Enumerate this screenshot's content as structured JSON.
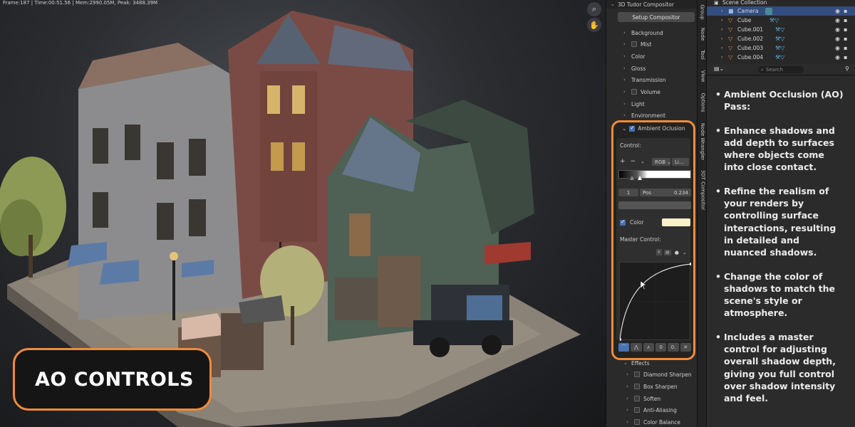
{
  "viewport": {
    "stats": "Frame:187 | Time:00:51.56 | Mem:2990.05M, Peak: 3488.39M",
    "zoom_icon": "zoom-icon",
    "hand_icon": "hand-icon",
    "overlay_label": "AO CONTROLS"
  },
  "properties": {
    "header_title": "3D Tudor Compositor",
    "setup_button": "Setup Compositor",
    "sections": [
      {
        "label": "Background",
        "checkbox": false
      },
      {
        "label": "Mist",
        "checkbox": true
      },
      {
        "label": "Color",
        "checkbox": false
      },
      {
        "label": "Gloss",
        "checkbox": false
      },
      {
        "label": "Transmission",
        "checkbox": false
      },
      {
        "label": "Volume",
        "checkbox": true
      },
      {
        "label": "Light",
        "checkbox": false
      },
      {
        "label": "Environment",
        "checkbox": false
      }
    ],
    "ao": {
      "title": "Ambient Oclusion",
      "control_label": "Control:",
      "color_mode": "RGB",
      "interp": "Li...",
      "index": "1",
      "pos_label": "Pos",
      "pos_value": "0.234",
      "color_label": "Color",
      "color_swatch": "#fbf1c9",
      "master_label": "Master Control:",
      "curve_values": [
        "0",
        "0."
      ]
    },
    "effects": {
      "title": "Effects",
      "items": [
        "Diamond Sharpen",
        "Box Sharpen",
        "Soften",
        "Anti-Aliasing",
        "Color Balance"
      ]
    }
  },
  "side_tabs": [
    "Group",
    "Node",
    "Tool",
    "View",
    "Options",
    "Node Wrangler",
    "3DT Compositor"
  ],
  "outliner": {
    "collection": "Scene Collection",
    "items": [
      {
        "name": "Camera",
        "selected": true
      },
      {
        "name": "Cube",
        "selected": false
      },
      {
        "name": "Cube.001",
        "selected": false
      },
      {
        "name": "Cube.002",
        "selected": false
      },
      {
        "name": "Cube.003",
        "selected": false
      },
      {
        "name": "Cube.004",
        "selected": false
      }
    ],
    "search_placeholder": "Search"
  },
  "notes": [
    "Ambient Occlusion (AO) Pass:",
    "Enhance shadows and add depth to surfaces where objects come into close contact.",
    "Refine the realism of your renders by controlling surface interactions, resulting in detailed and nuanced shadows.",
    "Change the color of shadows to match the scene's style or atmosphere.",
    "Includes a master control for adjusting overall shadow depth, giving you full control over shadow intensity and feel."
  ],
  "colors": {
    "accent_orange": "#f08c3a",
    "selection_blue": "#334d80",
    "checkbox_blue": "#4772b3"
  }
}
